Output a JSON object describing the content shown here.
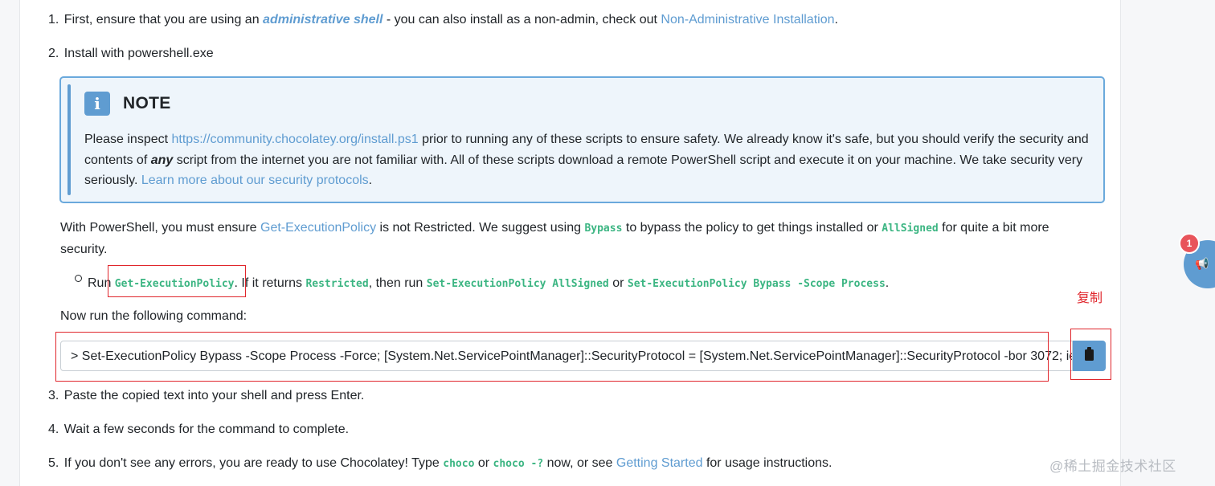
{
  "step1": {
    "num": "1.",
    "text_a": "First, ensure that you are using an ",
    "admin_link": "administrative shell",
    "text_b": " - you can also install as a non-admin, check out ",
    "nonadmin_link": "Non-Administrative Installation",
    "text_c": "."
  },
  "step2": {
    "num": "2.",
    "text": "Install with powershell.exe"
  },
  "note": {
    "icon_glyph": "i",
    "icon": "info-icon",
    "title": "NOTE",
    "text_a": "Please inspect ",
    "install_link": "https://community.chocolatey.org/install.ps1",
    "text_b": " prior to running any of these scripts to ensure safety. We already know it's safe, but you should verify the security and contents of ",
    "emphasis": "any",
    "text_c": " script from the internet you are not familiar with. All of these scripts download a remote PowerShell script and execute it on your machine. We take security very seriously. ",
    "security_link": "Learn more about our security protocols",
    "text_d": "."
  },
  "policy_para": {
    "text_a": "With PowerShell, you must ensure ",
    "policy_link": "Get-ExecutionPolicy",
    "text_b": " is not Restricted. We suggest using ",
    "code_bypass": "Bypass",
    "text_c": " to bypass the policy to get things installed or ",
    "code_allsigned": "AllSigned",
    "text_d": " for quite a bit more security."
  },
  "bullet": {
    "text_a": "Run ",
    "code_get": "Get-ExecutionPolicy",
    "text_b": ". If it returns ",
    "code_restricted": "Restricted",
    "text_c": ", then run ",
    "code_set_allsigned": "Set-ExecutionPolicy AllSigned",
    "text_d": " or ",
    "code_set_bypass": "Set-ExecutionPolicy Bypass -Scope Process",
    "text_e": "."
  },
  "command": {
    "intro": "Now run the following command:",
    "value": "> Set-ExecutionPolicy Bypass -Scope Process -Force; [System.Net.ServicePointManager]::SecurityProtocol = [System.Net.ServicePointManager]::SecurityProtocol -bor 3072; ie",
    "copy_icon": "clipboard-icon"
  },
  "annotation": {
    "copy_label": "复制"
  },
  "step3": {
    "num": "3.",
    "text": "Paste the copied text into your shell and press Enter."
  },
  "step4": {
    "num": "4.",
    "text": "Wait a few seconds for the command to complete."
  },
  "step5": {
    "num": "5.",
    "text_a": "If you don't see any errors, you are ready to use Chocolatey! Type ",
    "code_choco": "choco",
    "text_b": " or ",
    "code_choco_help": "choco -?",
    "text_c": " now, or see ",
    "getting_started_link": "Getting Started",
    "text_d": " for usage instructions."
  },
  "feedback": {
    "badge_count": "1",
    "icon": "megaphone-icon"
  },
  "watermark": "@稀土掘金技术社区",
  "colors": {
    "link": "#5f9cd1",
    "code": "#3bb582",
    "note_bg": "#eef5fb",
    "annotation_red": "#e0262c",
    "badge": "#e8545b"
  }
}
